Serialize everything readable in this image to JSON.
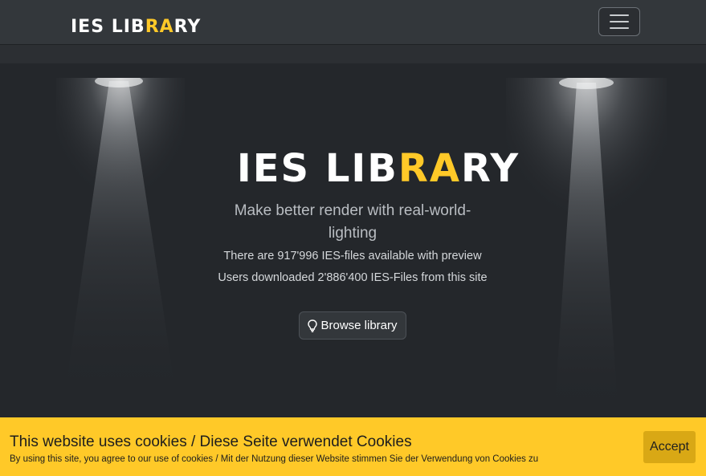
{
  "navbar": {
    "brand_prefix": "IES LIB",
    "brand_accent": "RA",
    "brand_suffix": "RY",
    "menu_icon": "hamburger-icon"
  },
  "hero": {
    "logo_prefix": "IES LIB",
    "logo_accent": "RA",
    "logo_suffix": "RY",
    "tagline": "Make better render with real-world-lighting",
    "files_stat": "There are 917'996 IES-files available with preview",
    "downloads_stat": "Users downloaded 2'886'400 IES-Files from this site",
    "browse_label": "Browse library",
    "browse_icon": "lightbulb-icon"
  },
  "cookie_banner": {
    "title": "This website uses cookies / Diese Seite verwendet Cookies",
    "text": "By using this site, you agree to our use of cookies / Mit der Nutzung dieser Website stimmen Sie der Verwendung von Cookies zu",
    "accept_label": "Accept"
  },
  "colors": {
    "accent": "#ffc928",
    "navbar_bg": "#33373b",
    "hero_bg": "#24272b",
    "cookie_bg": "#ffc928",
    "accept_bg": "#d9a815"
  }
}
